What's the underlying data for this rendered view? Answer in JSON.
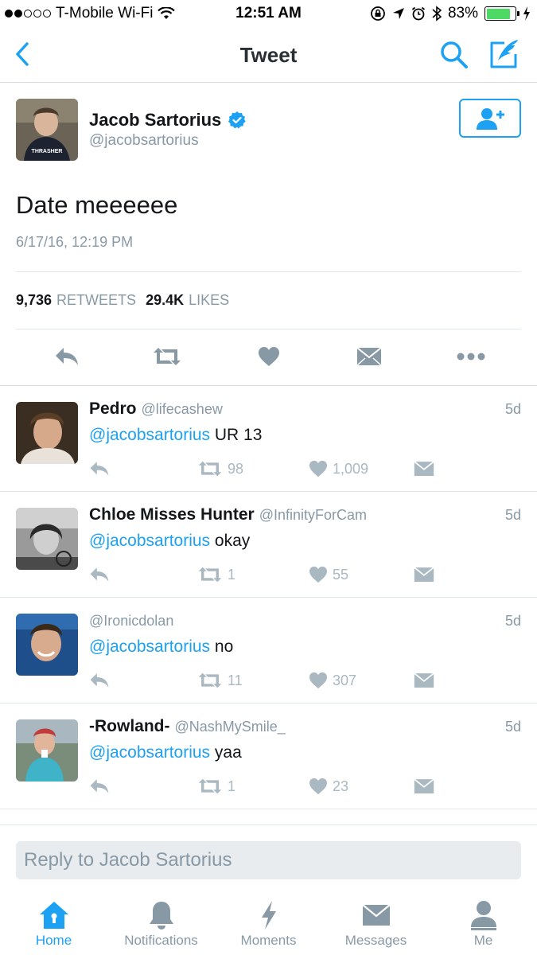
{
  "status_bar": {
    "carrier": "T-Mobile Wi-Fi",
    "time": "12:51 AM",
    "battery_percent": "83%",
    "battery_level": 0.83,
    "icons": [
      "signal-dots-icon",
      "wifi-icon",
      "rotation-lock-icon",
      "location-icon",
      "alarm-icon",
      "bluetooth-icon",
      "battery-icon",
      "charging-icon"
    ]
  },
  "nav": {
    "title": "Tweet",
    "icons": [
      "back-chevron-icon",
      "search-icon",
      "compose-icon"
    ]
  },
  "tweet": {
    "author_name": "Jacob Sartorius",
    "author_handle": "@jacobsartorius",
    "verified": true,
    "text": "Date meeeeee",
    "date": "6/17/16, 12:19 PM",
    "retweets_count": "9,736",
    "retweets_label": "RETWEETS",
    "likes_count": "29.4K",
    "likes_label": "LIKES",
    "action_icons": [
      "reply-icon",
      "retweet-icon",
      "like-icon",
      "direct-message-icon",
      "more-icon"
    ]
  },
  "replies": [
    {
      "name": "Pedro",
      "handle": "@lifecashew",
      "age": "5d",
      "mention": "@jacobsartorius",
      "text": "UR 13",
      "retweets": "98",
      "likes": "1,009"
    },
    {
      "name": "Chloe Misses Hunter",
      "handle": "@InfinityForCam",
      "age": "5d",
      "mention": "@jacobsartorius",
      "text": "okay",
      "retweets": "1",
      "likes": "55"
    },
    {
      "name": "",
      "handle": "@Ironicdolan",
      "age": "5d",
      "mention": "@jacobsartorius",
      "text": "no",
      "retweets": "11",
      "likes": "307"
    },
    {
      "name": "-Rowland-",
      "handle": "@NashMySmile_",
      "age": "5d",
      "mention": "@jacobsartorius",
      "text": "yaa",
      "retweets": "1",
      "likes": "23"
    }
  ],
  "reply_box": {
    "placeholder": "Reply to Jacob Sartorius"
  },
  "tab_bar": {
    "tabs": [
      {
        "label": "Home",
        "icon": "home-icon",
        "active": true
      },
      {
        "label": "Notifications",
        "icon": "bell-icon",
        "active": false
      },
      {
        "label": "Moments",
        "icon": "lightning-icon",
        "active": false
      },
      {
        "label": "Messages",
        "icon": "envelope-icon",
        "active": false
      },
      {
        "label": "Me",
        "icon": "person-icon",
        "active": false
      }
    ]
  },
  "colors": {
    "accent": "#1da1f2",
    "text_primary": "#14171a",
    "text_secondary": "#8899a6",
    "icon_gray": "#aab8c2",
    "battery_green": "#4cd964"
  }
}
